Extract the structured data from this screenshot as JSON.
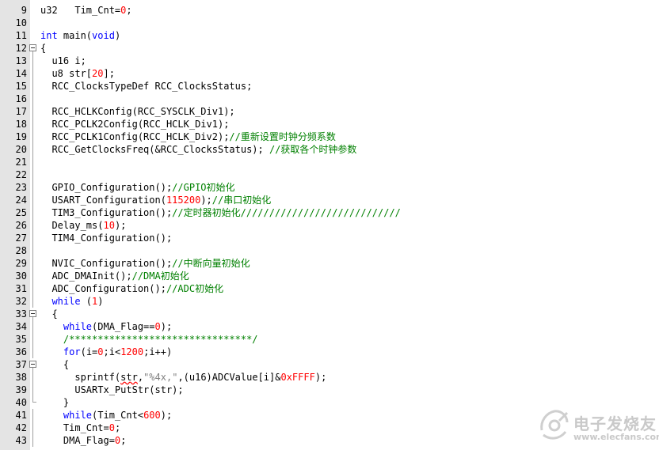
{
  "colors": {
    "keyword": "#0000ff",
    "number": "#ff0000",
    "comment": "#008000",
    "string": "#808080",
    "gutter": "#e4e4e4"
  },
  "lines": [
    {
      "n": "9",
      "parts": [
        [
          "t",
          "u32   Tim_Cnt="
        ],
        [
          "n",
          "0"
        ],
        [
          "t",
          ";"
        ]
      ]
    },
    {
      "n": "10",
      "parts": []
    },
    {
      "n": "11",
      "parts": [
        [
          "k",
          "int"
        ],
        [
          "t",
          " main("
        ],
        [
          "k",
          "void"
        ],
        [
          "t",
          ")"
        ]
      ]
    },
    {
      "n": "12",
      "fold": "open",
      "parts": [
        [
          "t",
          "{"
        ]
      ]
    },
    {
      "n": "13",
      "parts": [
        [
          "t",
          "  u16 i;"
        ]
      ]
    },
    {
      "n": "14",
      "parts": [
        [
          "t",
          "  u8 str["
        ],
        [
          "n",
          "20"
        ],
        [
          "t",
          "];"
        ]
      ]
    },
    {
      "n": "15",
      "parts": [
        [
          "t",
          "  RCC_ClocksTypeDef RCC_ClocksStatus;"
        ]
      ]
    },
    {
      "n": "16",
      "parts": []
    },
    {
      "n": "17",
      "parts": [
        [
          "t",
          "  RCC_HCLKConfig(RCC_SYSCLK_Div1);"
        ]
      ]
    },
    {
      "n": "18",
      "parts": [
        [
          "t",
          "  RCC_PCLK2Config(RCC_HCLK_Div1);"
        ]
      ]
    },
    {
      "n": "19",
      "parts": [
        [
          "t",
          "  RCC_PCLK1Config(RCC_HCLK_Div2);"
        ],
        [
          "c",
          "//重新设置时钟分频系数"
        ]
      ]
    },
    {
      "n": "20",
      "parts": [
        [
          "t",
          "  RCC_GetClocksFreq(&RCC_ClocksStatus); "
        ],
        [
          "c",
          "//获取各个时钟参数"
        ]
      ]
    },
    {
      "n": "21",
      "parts": []
    },
    {
      "n": "22",
      "parts": []
    },
    {
      "n": "23",
      "parts": [
        [
          "t",
          "  GPIO_Configuration();"
        ],
        [
          "c",
          "//GPIO初始化"
        ]
      ]
    },
    {
      "n": "24",
      "parts": [
        [
          "t",
          "  USART_Configuration("
        ],
        [
          "n",
          "115200"
        ],
        [
          "t",
          ");"
        ],
        [
          "c",
          "//串口初始化"
        ]
      ]
    },
    {
      "n": "25",
      "parts": [
        [
          "t",
          "  TIM3_Configuration();"
        ],
        [
          "c",
          "//定时器初始化////////////////////////////"
        ]
      ]
    },
    {
      "n": "26",
      "parts": [
        [
          "t",
          "  Delay_ms("
        ],
        [
          "n",
          "10"
        ],
        [
          "t",
          ");"
        ]
      ]
    },
    {
      "n": "27",
      "parts": [
        [
          "t",
          "  TIM4_Configuration();"
        ]
      ]
    },
    {
      "n": "28",
      "parts": []
    },
    {
      "n": "29",
      "parts": [
        [
          "t",
          "  NVIC_Configuration();"
        ],
        [
          "c",
          "//中断向量初始化"
        ]
      ]
    },
    {
      "n": "30",
      "parts": [
        [
          "t",
          "  ADC_DMAInit();"
        ],
        [
          "c",
          "//DMA初始化"
        ]
      ]
    },
    {
      "n": "31",
      "parts": [
        [
          "t",
          "  ADC_Configuration();"
        ],
        [
          "c",
          "//ADC初始化"
        ]
      ]
    },
    {
      "n": "32",
      "parts": [
        [
          "t",
          "  "
        ],
        [
          "k",
          "while"
        ],
        [
          "t",
          " ("
        ],
        [
          "n",
          "1"
        ],
        [
          "t",
          ")"
        ]
      ]
    },
    {
      "n": "33",
      "fold": "open",
      "parts": [
        [
          "t",
          "  {"
        ]
      ]
    },
    {
      "n": "34",
      "parts": [
        [
          "t",
          "    "
        ],
        [
          "k",
          "while"
        ],
        [
          "t",
          "(DMA_Flag=="
        ],
        [
          "n",
          "0"
        ],
        [
          "t",
          ");"
        ]
      ]
    },
    {
      "n": "35",
      "parts": [
        [
          "c",
          "    /********************************/"
        ]
      ]
    },
    {
      "n": "36",
      "parts": [
        [
          "t",
          "    "
        ],
        [
          "k",
          "for"
        ],
        [
          "t",
          "(i="
        ],
        [
          "n",
          "0"
        ],
        [
          "t",
          ";i<"
        ],
        [
          "n",
          "1200"
        ],
        [
          "t",
          ";i++)"
        ]
      ]
    },
    {
      "n": "37",
      "fold": "open",
      "parts": [
        [
          "t",
          "    {"
        ]
      ]
    },
    {
      "n": "38",
      "parts": [
        [
          "t",
          "      sprintf("
        ],
        [
          "u",
          "str"
        ],
        [
          "t",
          ","
        ],
        [
          "s",
          "\"%4x,\""
        ],
        [
          "t",
          ",(u16)ADCValue[i]&"
        ],
        [
          "n",
          "0xFFFF"
        ],
        [
          "t",
          ");"
        ]
      ]
    },
    {
      "n": "39",
      "parts": [
        [
          "t",
          "      USARTx_PutStr(str);"
        ]
      ]
    },
    {
      "n": "40",
      "fold": "end",
      "parts": [
        [
          "t",
          "    }"
        ]
      ]
    },
    {
      "n": "41",
      "parts": [
        [
          "t",
          "    "
        ],
        [
          "k",
          "while"
        ],
        [
          "t",
          "(Tim_Cnt<"
        ],
        [
          "n",
          "600"
        ],
        [
          "t",
          ");"
        ]
      ]
    },
    {
      "n": "42",
      "parts": [
        [
          "t",
          "    Tim_Cnt="
        ],
        [
          "n",
          "0"
        ],
        [
          "t",
          ";"
        ]
      ]
    },
    {
      "n": "43",
      "parts": [
        [
          "t",
          "    DMA_Flag="
        ],
        [
          "n",
          "0"
        ],
        [
          "t",
          ";"
        ]
      ]
    }
  ],
  "watermark": {
    "text_cn": "电子发烧友",
    "url": "www.elecfans.com",
    "icon": "elecfans-logo-icon"
  }
}
